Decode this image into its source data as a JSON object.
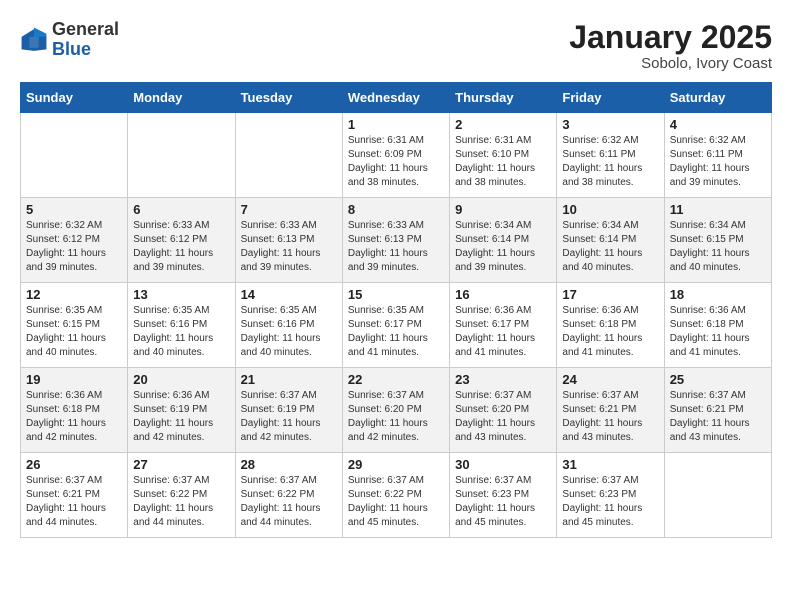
{
  "logo": {
    "general": "General",
    "blue": "Blue"
  },
  "header": {
    "month": "January 2025",
    "location": "Sobolo, Ivory Coast"
  },
  "weekdays": [
    "Sunday",
    "Monday",
    "Tuesday",
    "Wednesday",
    "Thursday",
    "Friday",
    "Saturday"
  ],
  "weeks": [
    [
      {
        "day": "",
        "sunrise": "",
        "sunset": "",
        "daylight": ""
      },
      {
        "day": "",
        "sunrise": "",
        "sunset": "",
        "daylight": ""
      },
      {
        "day": "",
        "sunrise": "",
        "sunset": "",
        "daylight": ""
      },
      {
        "day": "1",
        "sunrise": "Sunrise: 6:31 AM",
        "sunset": "Sunset: 6:09 PM",
        "daylight": "Daylight: 11 hours and 38 minutes."
      },
      {
        "day": "2",
        "sunrise": "Sunrise: 6:31 AM",
        "sunset": "Sunset: 6:10 PM",
        "daylight": "Daylight: 11 hours and 38 minutes."
      },
      {
        "day": "3",
        "sunrise": "Sunrise: 6:32 AM",
        "sunset": "Sunset: 6:11 PM",
        "daylight": "Daylight: 11 hours and 38 minutes."
      },
      {
        "day": "4",
        "sunrise": "Sunrise: 6:32 AM",
        "sunset": "Sunset: 6:11 PM",
        "daylight": "Daylight: 11 hours and 39 minutes."
      }
    ],
    [
      {
        "day": "5",
        "sunrise": "Sunrise: 6:32 AM",
        "sunset": "Sunset: 6:12 PM",
        "daylight": "Daylight: 11 hours and 39 minutes."
      },
      {
        "day": "6",
        "sunrise": "Sunrise: 6:33 AM",
        "sunset": "Sunset: 6:12 PM",
        "daylight": "Daylight: 11 hours and 39 minutes."
      },
      {
        "day": "7",
        "sunrise": "Sunrise: 6:33 AM",
        "sunset": "Sunset: 6:13 PM",
        "daylight": "Daylight: 11 hours and 39 minutes."
      },
      {
        "day": "8",
        "sunrise": "Sunrise: 6:33 AM",
        "sunset": "Sunset: 6:13 PM",
        "daylight": "Daylight: 11 hours and 39 minutes."
      },
      {
        "day": "9",
        "sunrise": "Sunrise: 6:34 AM",
        "sunset": "Sunset: 6:14 PM",
        "daylight": "Daylight: 11 hours and 39 minutes."
      },
      {
        "day": "10",
        "sunrise": "Sunrise: 6:34 AM",
        "sunset": "Sunset: 6:14 PM",
        "daylight": "Daylight: 11 hours and 40 minutes."
      },
      {
        "day": "11",
        "sunrise": "Sunrise: 6:34 AM",
        "sunset": "Sunset: 6:15 PM",
        "daylight": "Daylight: 11 hours and 40 minutes."
      }
    ],
    [
      {
        "day": "12",
        "sunrise": "Sunrise: 6:35 AM",
        "sunset": "Sunset: 6:15 PM",
        "daylight": "Daylight: 11 hours and 40 minutes."
      },
      {
        "day": "13",
        "sunrise": "Sunrise: 6:35 AM",
        "sunset": "Sunset: 6:16 PM",
        "daylight": "Daylight: 11 hours and 40 minutes."
      },
      {
        "day": "14",
        "sunrise": "Sunrise: 6:35 AM",
        "sunset": "Sunset: 6:16 PM",
        "daylight": "Daylight: 11 hours and 40 minutes."
      },
      {
        "day": "15",
        "sunrise": "Sunrise: 6:35 AM",
        "sunset": "Sunset: 6:17 PM",
        "daylight": "Daylight: 11 hours and 41 minutes."
      },
      {
        "day": "16",
        "sunrise": "Sunrise: 6:36 AM",
        "sunset": "Sunset: 6:17 PM",
        "daylight": "Daylight: 11 hours and 41 minutes."
      },
      {
        "day": "17",
        "sunrise": "Sunrise: 6:36 AM",
        "sunset": "Sunset: 6:18 PM",
        "daylight": "Daylight: 11 hours and 41 minutes."
      },
      {
        "day": "18",
        "sunrise": "Sunrise: 6:36 AM",
        "sunset": "Sunset: 6:18 PM",
        "daylight": "Daylight: 11 hours and 41 minutes."
      }
    ],
    [
      {
        "day": "19",
        "sunrise": "Sunrise: 6:36 AM",
        "sunset": "Sunset: 6:18 PM",
        "daylight": "Daylight: 11 hours and 42 minutes."
      },
      {
        "day": "20",
        "sunrise": "Sunrise: 6:36 AM",
        "sunset": "Sunset: 6:19 PM",
        "daylight": "Daylight: 11 hours and 42 minutes."
      },
      {
        "day": "21",
        "sunrise": "Sunrise: 6:37 AM",
        "sunset": "Sunset: 6:19 PM",
        "daylight": "Daylight: 11 hours and 42 minutes."
      },
      {
        "day": "22",
        "sunrise": "Sunrise: 6:37 AM",
        "sunset": "Sunset: 6:20 PM",
        "daylight": "Daylight: 11 hours and 42 minutes."
      },
      {
        "day": "23",
        "sunrise": "Sunrise: 6:37 AM",
        "sunset": "Sunset: 6:20 PM",
        "daylight": "Daylight: 11 hours and 43 minutes."
      },
      {
        "day": "24",
        "sunrise": "Sunrise: 6:37 AM",
        "sunset": "Sunset: 6:21 PM",
        "daylight": "Daylight: 11 hours and 43 minutes."
      },
      {
        "day": "25",
        "sunrise": "Sunrise: 6:37 AM",
        "sunset": "Sunset: 6:21 PM",
        "daylight": "Daylight: 11 hours and 43 minutes."
      }
    ],
    [
      {
        "day": "26",
        "sunrise": "Sunrise: 6:37 AM",
        "sunset": "Sunset: 6:21 PM",
        "daylight": "Daylight: 11 hours and 44 minutes."
      },
      {
        "day": "27",
        "sunrise": "Sunrise: 6:37 AM",
        "sunset": "Sunset: 6:22 PM",
        "daylight": "Daylight: 11 hours and 44 minutes."
      },
      {
        "day": "28",
        "sunrise": "Sunrise: 6:37 AM",
        "sunset": "Sunset: 6:22 PM",
        "daylight": "Daylight: 11 hours and 44 minutes."
      },
      {
        "day": "29",
        "sunrise": "Sunrise: 6:37 AM",
        "sunset": "Sunset: 6:22 PM",
        "daylight": "Daylight: 11 hours and 45 minutes."
      },
      {
        "day": "30",
        "sunrise": "Sunrise: 6:37 AM",
        "sunset": "Sunset: 6:23 PM",
        "daylight": "Daylight: 11 hours and 45 minutes."
      },
      {
        "day": "31",
        "sunrise": "Sunrise: 6:37 AM",
        "sunset": "Sunset: 6:23 PM",
        "daylight": "Daylight: 11 hours and 45 minutes."
      },
      {
        "day": "",
        "sunrise": "",
        "sunset": "",
        "daylight": ""
      }
    ]
  ]
}
